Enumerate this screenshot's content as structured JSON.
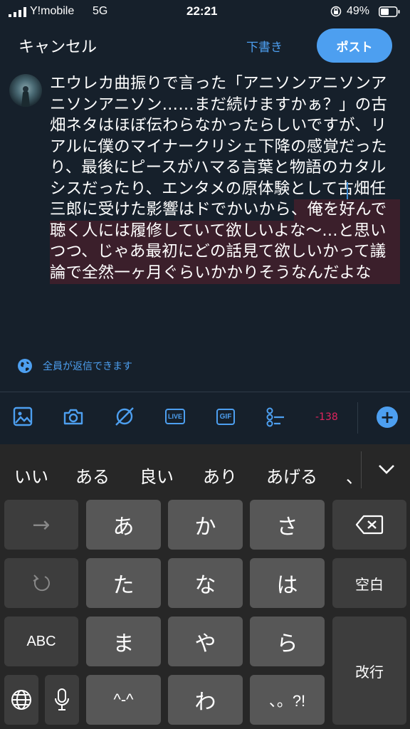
{
  "status_bar": {
    "carrier": "Y!mobile",
    "network": "5G",
    "time": "22:21",
    "battery_percent": "49%"
  },
  "header": {
    "cancel_label": "キャンセル",
    "drafts_label": "下書き",
    "post_label": "ポスト"
  },
  "tweet": {
    "lines": [
      "エウレカ曲振りで言った「アニソンアニソンア",
      "ニソンアニソン……まだ続けますかぁ？」の古",
      "畑ネタはほぼ伝わらなかったらしいですが、リ",
      "アルに僕のマイナークリシェ下降の感覚だった",
      "り、最後にピースがハマる言葉と物語のカタル",
      "シスだったり、エンタメの原体験として古畑任",
      "三郎に受けた影響はドでかいから、俺を好んで",
      "聴く人には履修していて欲しいよな〜…と思い",
      "つつ、じゃあ最初にどの話見て欲しいかって議",
      "論で全然一ヶ月ぐらいかかりそうなんだよな"
    ]
  },
  "reply_setting": {
    "label": "全員が返信できます",
    "icon": "globe-icon"
  },
  "toolbar": {
    "icons": [
      "image-icon",
      "camera-icon",
      "no-signal-icon",
      "live-icon",
      "gif-icon",
      "poll-icon"
    ],
    "live_label": "LIVE",
    "gif_label": "GIF",
    "char_count": "-138",
    "add_label": "+"
  },
  "keyboard": {
    "suggestions": [
      "いい",
      "ある",
      "良い",
      "あり",
      "あげる",
      "、"
    ],
    "keys": {
      "arrow": "→",
      "a": "あ",
      "ka": "か",
      "sa": "さ",
      "ta": "た",
      "na": "な",
      "ha": "は",
      "space": "空白",
      "abc": "ABC",
      "ma": "ま",
      "ya": "や",
      "ra": "ら",
      "return": "改行",
      "kaomoji": "^-^",
      "wa": "わ",
      "punct": "、。?!"
    }
  },
  "colors": {
    "background": "#16202b",
    "accent": "#4d9ff0",
    "warning": "#e0245e",
    "highlight": "#3b1f2b"
  }
}
